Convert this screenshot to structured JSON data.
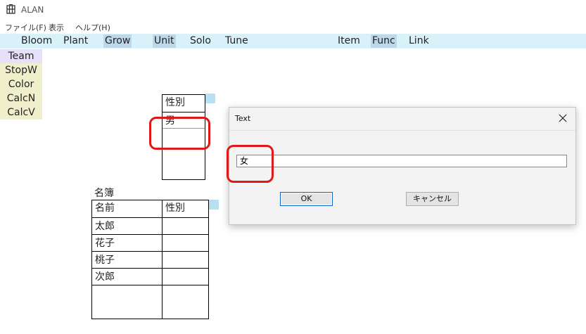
{
  "window": {
    "title": "ALAN"
  },
  "menu": {
    "items": [
      "ファイル(F)",
      "表示",
      "ヘルプ(H)"
    ]
  },
  "toolbar": {
    "items": [
      "Bloom",
      "Plant",
      "Grow",
      "Unit",
      "Solo",
      "Tune",
      "Item",
      "Func",
      "Link"
    ],
    "highlighted": [
      "Grow",
      "Unit",
      "Func"
    ]
  },
  "sidebar": {
    "items": [
      "Team",
      "StopW",
      "Color",
      "CalcN",
      "CalcV"
    ]
  },
  "gender_table": {
    "header": "性別",
    "values": [
      "男",
      ""
    ]
  },
  "roster": {
    "caption": "名簿",
    "headers": [
      "名前",
      "性別"
    ],
    "rows": [
      [
        "太郎",
        ""
      ],
      [
        "花子",
        ""
      ],
      [
        "桃子",
        ""
      ],
      [
        "次郎",
        ""
      ]
    ]
  },
  "dialog": {
    "title": "Text",
    "input_value": "女",
    "ok_label": "OK",
    "cancel_label": "キャンセル"
  },
  "colors": {
    "toolbar_bg": "#d9f1f8",
    "highlight": "#bcd8ea",
    "annotation": "#e01818"
  }
}
